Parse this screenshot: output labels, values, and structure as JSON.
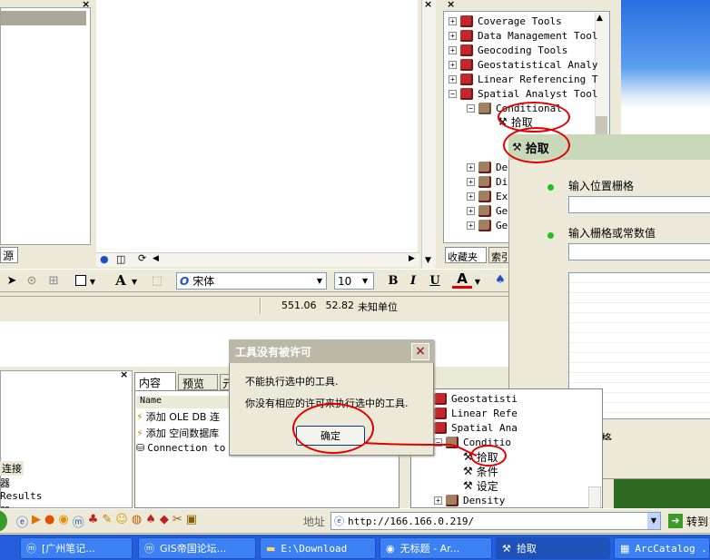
{
  "top_left_panel": {
    "tab_label": "源"
  },
  "toc_tabs": [
    "⊙",
    "◫",
    "⟳"
  ],
  "toolbox": {
    "items": [
      {
        "label": "Coverage Tools",
        "expander": "+"
      },
      {
        "label": "Data Management Tool",
        "expander": "+"
      },
      {
        "label": "Geocoding Tools",
        "expander": "+"
      },
      {
        "label": "Geostatistical Analy",
        "expander": "+"
      },
      {
        "label": "Linear Referencing T",
        "expander": "+"
      },
      {
        "label": "Spatial Analyst Tool",
        "expander": "−"
      }
    ],
    "conditional": "Conditional",
    "pick": "拾取",
    "sub_items": [
      "De",
      "Di",
      "Ex",
      "Ge",
      "Ge"
    ],
    "tabs": {
      "favorites": "收藏夹",
      "index": "索引"
    }
  },
  "drawing_toolbar": {
    "font": "宋体",
    "size": "10",
    "bold": "B",
    "italic": "I",
    "underline": "U",
    "font_color": "A",
    "text_tool": "A"
  },
  "status_bar": {
    "x": "551.06",
    "y": "52.82",
    "unit": "未知单位"
  },
  "tool_dialog": {
    "title": "拾取",
    "field1_label": "输入位置栅格",
    "field2_label": "输入栅格或常数值",
    "field3_label": "输出栅格"
  },
  "alert": {
    "title": "工具没有被许可",
    "line1": "不能执行选中的工具.",
    "line2": "你没有相应的许可来执行选中的工具.",
    "ok_label": "确定",
    "close": "×"
  },
  "catalog_tabs": {
    "contents": "内容",
    "preview": "预览",
    "metadata": "元"
  },
  "catalog": {
    "column_name": "Name",
    "rows": [
      "添加 OLE DB 连",
      "添加 空间数据库",
      "Connection to"
    ]
  },
  "left_bottom": {
    "items": [
      "连接",
      "器",
      "Results",
      "器"
    ]
  },
  "bottom_tree": {
    "items": [
      "Geostatisti",
      "Linear Refe",
      "Spatial Ana",
      "Conditio"
    ],
    "tools": [
      "拾取",
      "条件",
      "设定"
    ],
    "density": "Density"
  },
  "ie_bar": {
    "address_label": "地址",
    "url": "http://166.166.0.219/",
    "go_label": "转到"
  },
  "taskbar": {
    "items": [
      {
        "label": "[广州笔记...",
        "icon": "maxthon-icon"
      },
      {
        "label": "GIS帝国论坛...",
        "icon": "maxthon-icon"
      },
      {
        "label": "E:\\Download",
        "icon": "folder-icon"
      },
      {
        "label": "无标题 - Ar...",
        "icon": "globe-icon"
      },
      {
        "label": "拾取",
        "icon": "hammer-icon"
      },
      {
        "label": "ArcCatalog ...",
        "icon": "catalog-icon"
      }
    ]
  }
}
